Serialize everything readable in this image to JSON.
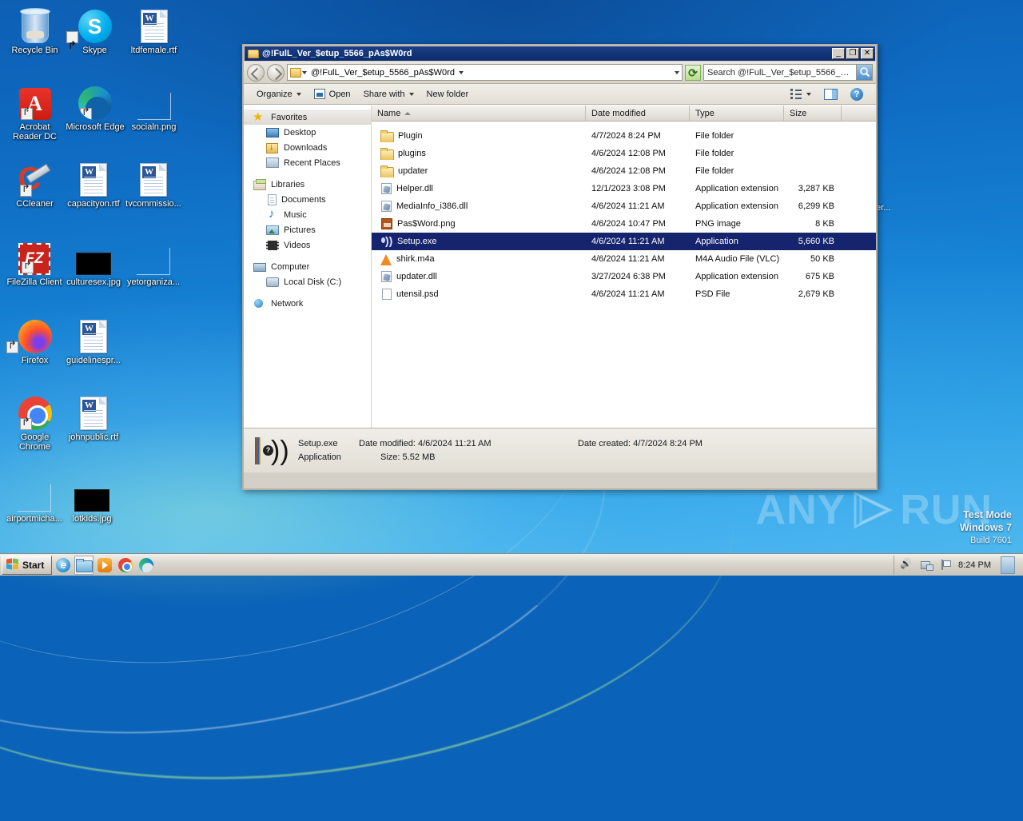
{
  "desktop": {
    "icons": [
      {
        "label": "Recycle Bin",
        "icon": "recycle-bin-icon",
        "shortcut": false
      },
      {
        "label": "Skype",
        "icon": "skype-icon",
        "shortcut": true
      },
      {
        "label": "ltdfemale.rtf",
        "icon": "rtf-document-icon",
        "shortcut": false
      },
      {
        "label": "Acrobat Reader DC",
        "icon": "acrobat-reader-icon",
        "shortcut": true
      },
      {
        "label": "Microsoft Edge",
        "icon": "microsoft-edge-icon",
        "shortcut": true
      },
      {
        "label": "socialn.png",
        "icon": "image-file-icon",
        "shortcut": false
      },
      {
        "label": "CCleaner",
        "icon": "ccleaner-icon",
        "shortcut": true
      },
      {
        "label": "capacityon.rtf",
        "icon": "rtf-document-icon",
        "shortcut": false
      },
      {
        "label": "tvcommissio...",
        "icon": "rtf-document-icon",
        "shortcut": false
      },
      {
        "label": "FileZilla Client",
        "icon": "filezilla-icon",
        "shortcut": true
      },
      {
        "label": "culturesex.jpg",
        "icon": "image-file-icon",
        "shortcut": false
      },
      {
        "label": "yetorganiza...",
        "icon": "image-file-icon",
        "shortcut": false
      },
      {
        "label": "Firefox",
        "icon": "firefox-icon",
        "shortcut": true
      },
      {
        "label": "guidelinespr...",
        "icon": "rtf-document-icon",
        "shortcut": false
      },
      {
        "label": "Google Chrome",
        "icon": "google-chrome-icon",
        "shortcut": true
      },
      {
        "label": "johnpublic.rtf",
        "icon": "rtf-document-icon",
        "shortcut": false
      },
      {
        "label": "airportmicha...",
        "icon": "image-file-icon",
        "shortcut": false
      },
      {
        "label": "lotkids.jpg",
        "icon": "image-file-icon",
        "shortcut": false
      }
    ],
    "watermark": {
      "text_left": "ANY",
      "text_right": "RUN"
    },
    "test_mode": {
      "line1": "Test Mode",
      "line2": "Windows 7",
      "line3": "Build 7601"
    }
  },
  "window": {
    "title": "@!FulL_Ver_$etup_5566_pAs$W0rd",
    "buttons": {
      "minimize": "_",
      "maximize": "❐",
      "close": "✕"
    },
    "nav": {
      "back_icon": "back-arrow-icon",
      "forward_icon": "forward-arrow-icon",
      "breadcrumb": "@!FulL_Ver_$etup_5566_pAs$W0rd",
      "refresh_icon": "refresh-icon",
      "search_placeholder": "Search @!FulL_Ver_$etup_5566_pAs$...",
      "search_icon": "search-icon"
    },
    "toolbar": {
      "organize": "Organize",
      "open": "Open",
      "share_with": "Share with",
      "new_folder": "New folder",
      "view_icon": "view-options-icon",
      "preview_pane_icon": "preview-pane-icon",
      "help_icon": "help-icon"
    }
  },
  "nav_pane": {
    "groups": [
      {
        "header": {
          "label": "Favorites",
          "icon": "favorites-star-icon",
          "selected": true
        },
        "children": [
          {
            "label": "Desktop",
            "icon": "desktop-icon"
          },
          {
            "label": "Downloads",
            "icon": "downloads-icon"
          },
          {
            "label": "Recent Places",
            "icon": "recent-places-icon"
          }
        ]
      },
      {
        "header": {
          "label": "Libraries",
          "icon": "libraries-icon",
          "selected": false
        },
        "children": [
          {
            "label": "Documents",
            "icon": "documents-icon"
          },
          {
            "label": "Music",
            "icon": "music-icon"
          },
          {
            "label": "Pictures",
            "icon": "pictures-icon"
          },
          {
            "label": "Videos",
            "icon": "videos-icon"
          }
        ]
      },
      {
        "header": {
          "label": "Computer",
          "icon": "computer-icon",
          "selected": false
        },
        "children": [
          {
            "label": "Local Disk (C:)",
            "icon": "local-disk-icon"
          }
        ]
      },
      {
        "header": {
          "label": "Network",
          "icon": "network-icon",
          "selected": false
        },
        "children": []
      }
    ]
  },
  "file_list": {
    "columns": [
      {
        "label": "Name",
        "sorted": true
      },
      {
        "label": "Date modified",
        "sorted": false
      },
      {
        "label": "Type",
        "sorted": false
      },
      {
        "label": "Size",
        "sorted": false
      }
    ],
    "rows": [
      {
        "name": "Plugin",
        "date": "4/7/2024 8:24 PM",
        "type": "File folder",
        "size": "",
        "icon": "folder-icon",
        "selected": false
      },
      {
        "name": "plugins",
        "date": "4/6/2024 12:08 PM",
        "type": "File folder",
        "size": "",
        "icon": "folder-icon",
        "selected": false
      },
      {
        "name": "updater",
        "date": "4/6/2024 12:08 PM",
        "type": "File folder",
        "size": "",
        "icon": "folder-icon",
        "selected": false
      },
      {
        "name": "Helper.dll",
        "date": "12/1/2023 3:08 PM",
        "type": "Application extension",
        "size": "3,287 KB",
        "icon": "dll-icon",
        "selected": false
      },
      {
        "name": "MediaInfo_i386.dll",
        "date": "4/6/2024 11:21 AM",
        "type": "Application extension",
        "size": "6,299 KB",
        "icon": "dll-icon",
        "selected": false
      },
      {
        "name": "Pas$Word.png",
        "date": "4/6/2024 10:47 PM",
        "type": "PNG image",
        "size": "8 KB",
        "icon": "png-image-icon",
        "selected": false
      },
      {
        "name": "Setup.exe",
        "date": "4/6/2024 11:21 AM",
        "type": "Application",
        "size": "5,660 KB",
        "icon": "application-icon",
        "selected": true
      },
      {
        "name": "shirk.m4a",
        "date": "4/6/2024 11:21 AM",
        "type": "M4A Audio File (VLC)",
        "size": "50 KB",
        "icon": "vlc-audio-icon",
        "selected": false
      },
      {
        "name": "updater.dll",
        "date": "3/27/2024 6:38 PM",
        "type": "Application extension",
        "size": "675 KB",
        "icon": "dll-icon",
        "selected": false
      },
      {
        "name": "utensil.psd",
        "date": "4/6/2024 11:21 AM",
        "type": "PSD File",
        "size": "2,679 KB",
        "icon": "psd-file-icon",
        "selected": false
      }
    ]
  },
  "details_pane": {
    "icon": "application-icon",
    "file_name": "Setup.exe",
    "date_modified_label": "Date modified:",
    "date_modified_value": "4/6/2024 11:21 AM",
    "date_created_label": "Date created:",
    "date_created_value": "4/7/2024 8:24 PM",
    "file_type": "Application",
    "size_label": "Size:",
    "size_value": "5.52 MB"
  },
  "taskbar": {
    "start_label": "Start",
    "quick_launch": [
      {
        "name": "internet-explorer",
        "active": false
      },
      {
        "name": "windows-explorer",
        "active": true
      },
      {
        "name": "windows-media-player",
        "active": false
      },
      {
        "name": "google-chrome",
        "active": false
      },
      {
        "name": "microsoft-edge",
        "active": false
      }
    ],
    "tray": {
      "volume_icon": "volume-icon",
      "network_icon": "network-icon",
      "action_center_icon": "flag-icon",
      "clock": "8:24 PM",
      "show_desktop_icon": "show-desktop-icon"
    }
  }
}
